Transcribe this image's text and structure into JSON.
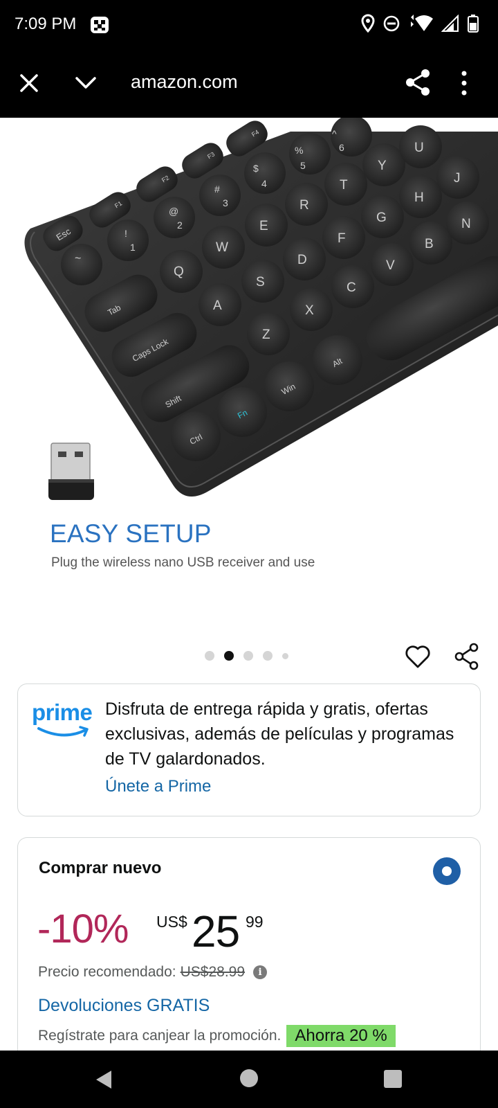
{
  "status_bar": {
    "time": "7:09 PM",
    "icons": [
      "app-notification-icon",
      "location-icon",
      "do-not-disturb-icon",
      "wifi-icon",
      "signal-icon",
      "battery-icon"
    ]
  },
  "browser": {
    "url": "amazon.com",
    "close_icon": "close-icon",
    "chevron_icon": "chevron-down-icon",
    "share_icon": "share-icon",
    "more_icon": "more-vert-icon"
  },
  "product_image": {
    "keys": {
      "row_fn": [
        "Esc",
        "F1",
        "F2",
        "F3",
        "F4"
      ],
      "row_num": [
        "~",
        "!\n1",
        "@\n2",
        "#\n3",
        "$\n4",
        "%\n5",
        "^\n6"
      ],
      "row_q": [
        "Tab",
        "Q",
        "W",
        "E",
        "R",
        "T",
        "Y",
        "U"
      ],
      "row_a": [
        "Caps Lock",
        "A",
        "S",
        "D",
        "F",
        "G",
        "H",
        "J"
      ],
      "row_z": [
        "Shift",
        "Z",
        "X",
        "C",
        "V",
        "B",
        "N"
      ],
      "row_bottom": [
        "Ctrl",
        "Fn",
        "Win",
        "Alt"
      ]
    },
    "headline": "EASY SETUP",
    "subline": "Plug the wireless nano USB receiver and use"
  },
  "carousel": {
    "dot_count": 5,
    "active_index": 1
  },
  "actions": {
    "wishlist_icon": "heart-icon",
    "share_icon": "share-icon"
  },
  "prime": {
    "logo_text": "prime",
    "message": "Disfruta de entrega rápida y gratis, ofertas exclusivas, además de películas y programas de TV galardonados.",
    "link": "Únete a Prime"
  },
  "buy_box": {
    "title": "Comprar nuevo",
    "discount": "-10%",
    "currency": "US$",
    "price_whole": "25",
    "price_fraction": "99",
    "list_price_label": "Precio recomendado:",
    "list_price_value": "US$28.99",
    "returns": "Devoluciones GRATIS",
    "promo_text": "Regístrate para canjear la promoción.",
    "promo_badge": "Ahorra 20 %",
    "accent_color": "#b12759",
    "link_color": "#1466a5"
  },
  "nav_bar": {
    "icons": [
      "back-icon",
      "home-icon",
      "recents-icon"
    ]
  }
}
